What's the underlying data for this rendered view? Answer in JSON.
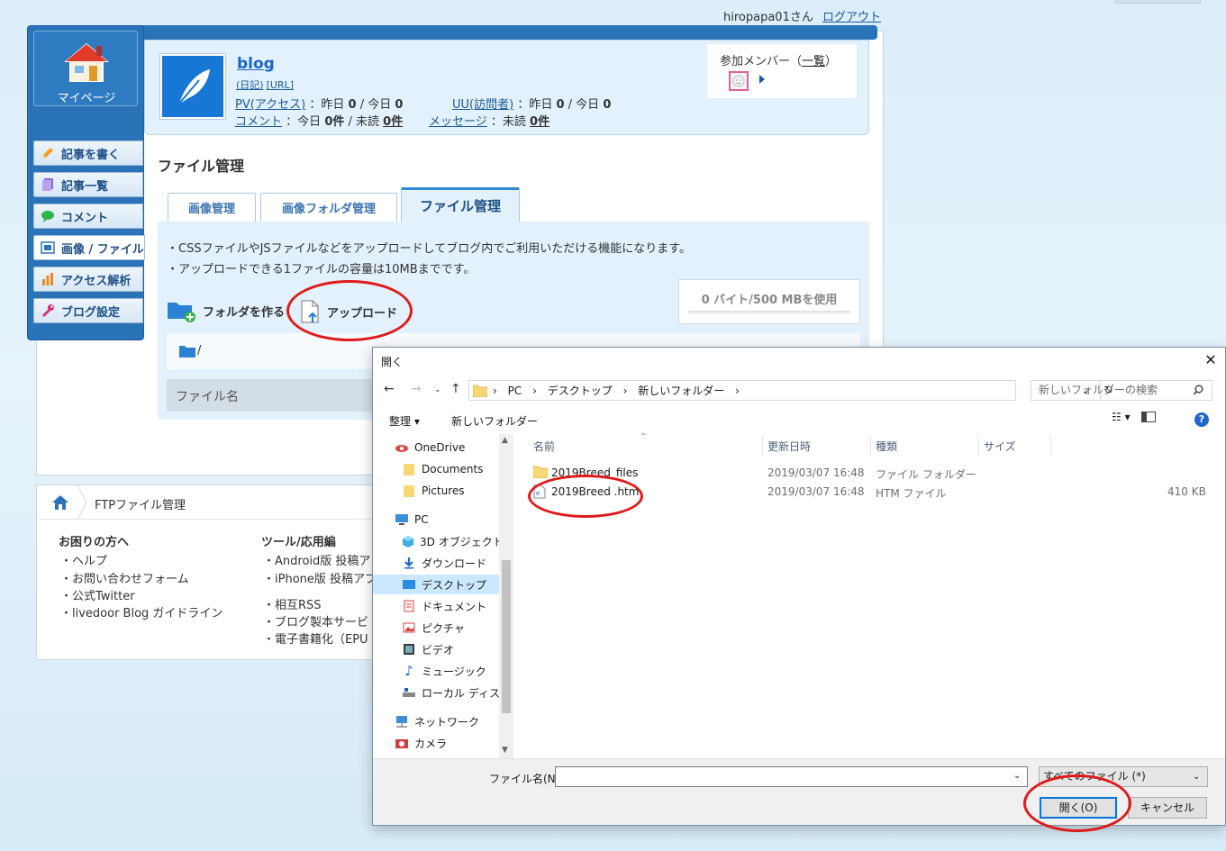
{
  "topbar": {
    "user": "hiropapa01さん",
    "logout": "ログアウト"
  },
  "sidebar": {
    "mypage": "マイページ",
    "items": [
      {
        "label": "記事を書く",
        "icon": "pencil-icon"
      },
      {
        "label": "記事一覧",
        "icon": "document-list-icon"
      },
      {
        "label": "コメント",
        "icon": "speech-bubble-icon"
      },
      {
        "label": "画像 / ファイル",
        "icon": "image-icon"
      },
      {
        "label": "アクセス解析",
        "icon": "bar-chart-icon"
      },
      {
        "label": "ブログ設定",
        "icon": "wrench-icon"
      }
    ],
    "active_index": 3
  },
  "blog": {
    "title": "blog",
    "link_diary": "(日記)",
    "link_url": "[URL]",
    "pv_label": "PV(アクセス)",
    "pv_text": "：昨日",
    "pv_yesterday": "0",
    "pv_sep": "/ 今日",
    "pv_today": "0",
    "uu_label": "UU(訪問者)",
    "uu_text": "：昨日",
    "uu_yesterday": "0",
    "uu_sep": "/ 今日",
    "uu_today": "0",
    "comment_label": "コメント",
    "comment_text": "：今日",
    "comment_today": "0件",
    "comment_sep": "/ 未読",
    "comment_unread": "0件",
    "message_label": "メッセージ",
    "message_text": "：未読",
    "message_unread": "0件",
    "members_label": "参加メンバー（",
    "members_link": "一覧",
    "members_close": "）"
  },
  "page": {
    "heading": "ファイル管理",
    "tabs": [
      "画像管理",
      "画像フォルダ管理",
      "ファイル管理"
    ],
    "active_tab": 2,
    "note1": "・CSSファイルやJSファイルなどをアップロードしてブログ内でご利用いただける機能になります。",
    "note2": "・アップロードできる1ファイルの容量は10MBまでです。",
    "usage": "0 バイト/500 MBを使用",
    "usage_fraction": 0,
    "make_folder": "フォルダを作る",
    "upload": "アップロード",
    "path": "/",
    "col_filename": "ファイル名"
  },
  "footer": {
    "crumb": "FTPファイル管理",
    "col1_head": "お困りの方へ",
    "col1_links": [
      "・ヘルプ",
      "・お問い合わせフォーム",
      "・公式Twitter",
      "・livedoor Blog ガイドライン"
    ],
    "col2_head": "ツール/応用編",
    "col2_links": [
      "・Android版 投稿アプ",
      "・iPhone版 投稿アプ",
      "・相互RSS",
      "・ブログ製本サービ",
      "・電子書籍化（EPU"
    ]
  },
  "dialog": {
    "title": "開く",
    "breadcrumbs": [
      "PC",
      "デスクトップ",
      "新しいフォルダー"
    ],
    "search_placeholder": "新しいフォルダーの検索",
    "organize": "整理 ▾",
    "new_folder": "新しいフォルダー",
    "tree": [
      {
        "label": "OneDrive",
        "icon": "onedrive-icon",
        "indent": 0
      },
      {
        "label": "Documents",
        "icon": "folder-icon",
        "indent": 1
      },
      {
        "label": "Pictures",
        "icon": "folder-icon",
        "indent": 1
      },
      {
        "label": "PC",
        "icon": "pc-icon",
        "indent": 0
      },
      {
        "label": "3D オブジェクト",
        "icon": "3d-object-icon",
        "indent": 1
      },
      {
        "label": "ダウンロード",
        "icon": "download-icon",
        "indent": 1
      },
      {
        "label": "デスクトップ",
        "icon": "desktop-icon",
        "indent": 1
      },
      {
        "label": "ドキュメント",
        "icon": "documents-icon",
        "indent": 1
      },
      {
        "label": "ピクチャ",
        "icon": "pictures-icon",
        "indent": 1
      },
      {
        "label": "ビデオ",
        "icon": "video-icon",
        "indent": 1
      },
      {
        "label": "ミュージック",
        "icon": "music-icon",
        "indent": 1
      },
      {
        "label": "ローカル ディスク (C",
        "icon": "disk-icon",
        "indent": 1
      },
      {
        "label": "ネットワーク",
        "icon": "network-icon",
        "indent": 0
      },
      {
        "label": "カメラ",
        "icon": "camera-icon",
        "indent": 0
      }
    ],
    "selected_tree": 6,
    "columns": [
      "名前",
      "更新日時",
      "種類",
      "サイズ"
    ],
    "files": [
      {
        "name": "2019Breed_files",
        "date": "2019/03/07 16:48",
        "type": "ファイル フォルダー",
        "size": "",
        "icon": "folder-icon"
      },
      {
        "name": "2019Breed .htm",
        "date": "2019/03/07 16:48",
        "type": "HTM ファイル",
        "size": "410 KB",
        "icon": "htm-file-icon"
      }
    ],
    "filename_label": "ファイル名(N):",
    "filename_value": "",
    "filetype": "すべてのファイル (*)",
    "open_btn": "開く(O)",
    "cancel_btn": "キャンセル"
  },
  "colors": {
    "brand_blue": "#2b73b8",
    "annotation_red": "#e01a1a",
    "selection": "#cce8ff"
  }
}
